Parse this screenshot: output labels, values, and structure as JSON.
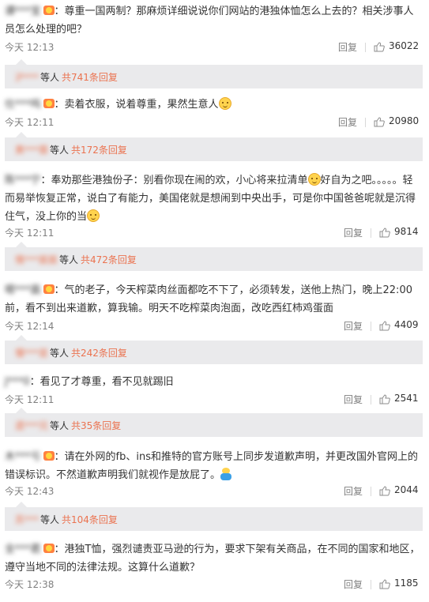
{
  "comments": [
    {
      "user": "谭***宝",
      "text": "：尊重一国两制？那麻烦详细说说你们网站的港独体恤怎么上去的？相关涉事人员怎么处理的吧？",
      "time": "今天 12:13",
      "reply": "回复",
      "likes": "36022",
      "sub": {
        "user": "沪***",
        "mid": "等人",
        "link": "共741条回复"
      }
    },
    {
      "user": "仕***呜",
      "text": "：卖着衣服，说着尊重，果然生意人",
      "time": "今天 12:11",
      "reply": "回复",
      "likes": "20980",
      "sub": {
        "user": "黄***蓉",
        "mid": "等人",
        "link": "共172条回复"
      }
    },
    {
      "user": "陈***宁",
      "text_a": "：奉劝那些港独份子：别看你现在闹的欢，小心将来拉清单",
      "text_b": "好自为之吧。。。。。轻而易举恢复正常，说白了有能力，美国佬就是想闹到中央出手，可是你中国爸爸呢就是沉得住气，没上你的当",
      "time": "今天 12:11",
      "reply": "回复",
      "likes": "9814",
      "sub": {
        "user": "情***宸宸",
        "mid": "等人",
        "link": "共472条回复"
      }
    },
    {
      "user": "嗯***面",
      "text": "：气的老子，今天榨菜肉丝面都吃不下了，必须转发，送他上热门，晚上22:00前，看不到出来道歉，算我输。明天不吃榨菜肉泡面，改吃西红柿鸡蛋面",
      "time": "今天 12:14",
      "reply": "回复",
      "likes": "4409",
      "sub": {
        "user": "慢***是",
        "mid": "等人",
        "link": "共242条回复"
      }
    },
    {
      "user": "J***0",
      "text": "：看见了才尊重，看不见就踢旧",
      "time": "今天 12:11",
      "reply": "回复",
      "likes": "2541",
      "sub": {
        "user": "遗***兄",
        "mid": "等人",
        "link": "共35条回复"
      }
    },
    {
      "user": "木***亏",
      "text": "：请在外网的fb、ins和推特的官方账号上同步发道歉声明，并更改国外官网上的错误标识。不然道歉声明我们就视作是放屁了。",
      "time": "今天 12:43",
      "reply": "回复",
      "likes": "2044",
      "sub": {
        "user": "苏***",
        "mid": "等人",
        "link": "共104条回复"
      }
    },
    {
      "user": "全***君",
      "text": "：港独T恤，强烈谴责亚马逊的行为，要求下架有关商品，在不同的国家和地区，遵守当地不同的法律法规。这算什么道歉？",
      "time": "今天 12:38",
      "reply": "回复",
      "likes": "1185"
    }
  ],
  "colors": {
    "link": "#eb7350",
    "muted": "#808080",
    "subbg": "#eaeaec",
    "badge": "#ff8140"
  },
  "icons": {
    "like": "thumbs-up-icon",
    "badge": "fan-badge-icon",
    "emoji": "smile-emoji-icon"
  }
}
